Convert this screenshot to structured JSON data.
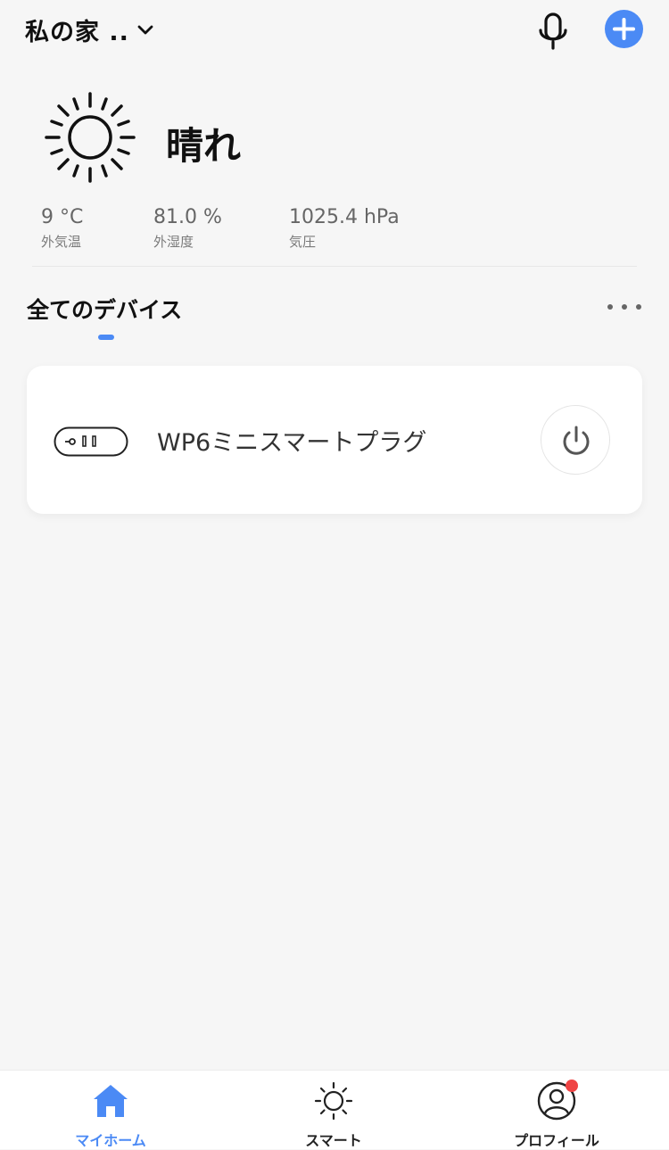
{
  "header": {
    "home_name": "私の家 ..",
    "icons": [
      "chevron-down-icon",
      "microphone-icon",
      "plus-icon"
    ]
  },
  "weather": {
    "icon": "sun-icon",
    "condition": "晴れ",
    "stats": [
      {
        "value": "9 °C",
        "label": "外気温"
      },
      {
        "value": "81.0 %",
        "label": "外湿度"
      },
      {
        "value": "1025.4 hPa",
        "label": "気圧"
      }
    ]
  },
  "devices": {
    "title": "全てのデバイス",
    "items": [
      {
        "name": "WP6ミニスマートプラグ",
        "icon": "smart-plug-icon",
        "power_icon": "power-icon"
      }
    ]
  },
  "tabbar": {
    "items": [
      {
        "label": "マイホーム",
        "icon": "home-icon",
        "active": true
      },
      {
        "label": "スマート",
        "icon": "sun-icon",
        "active": false
      },
      {
        "label": "プロフィール",
        "icon": "profile-icon",
        "active": false,
        "badge": true
      }
    ]
  },
  "colors": {
    "accent": "#4b8af5",
    "background": "#f6f6f6",
    "badge": "#ef4444"
  }
}
